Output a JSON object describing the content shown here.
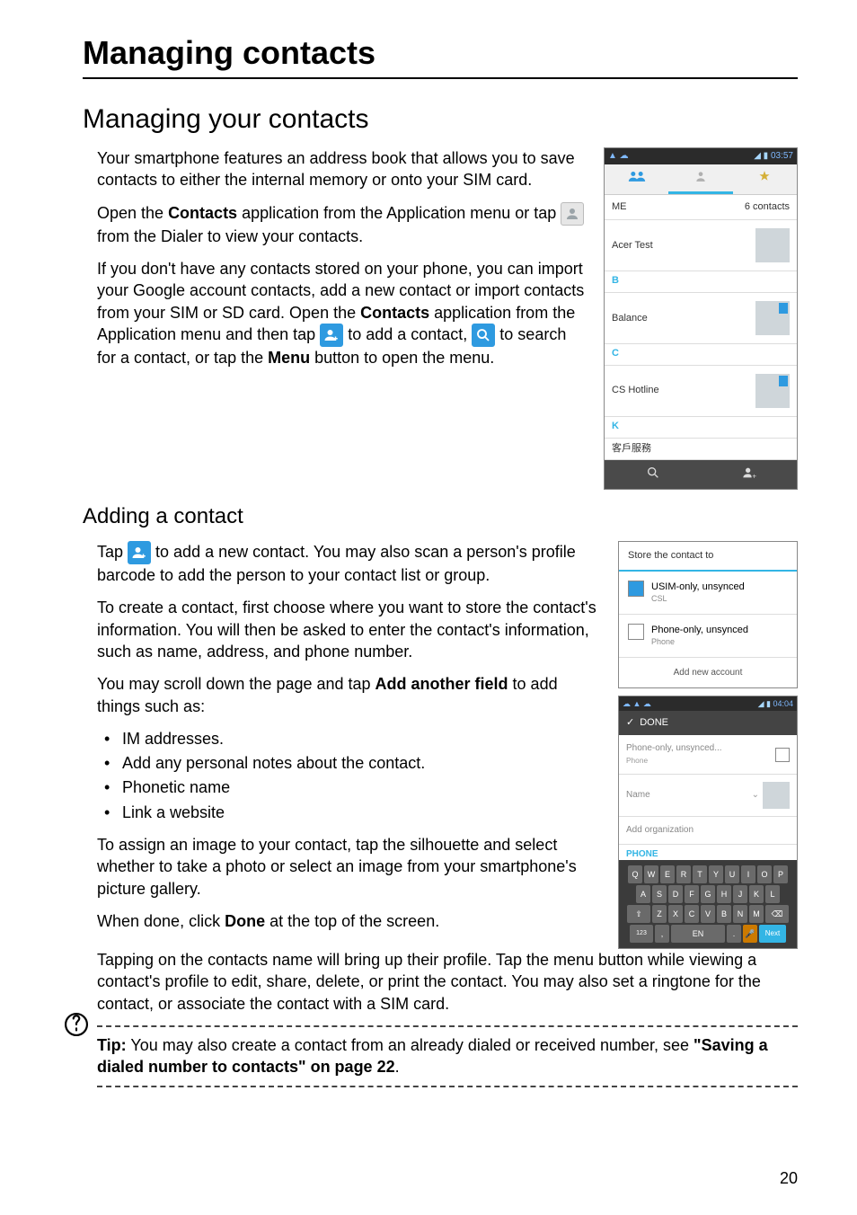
{
  "heading1": "Managing contacts",
  "heading2": "Managing your contacts",
  "heading3": "Adding a contact",
  "intro": {
    "p1": "Your smartphone features an address book that allows you to save contacts to either the internal memory or onto your SIM card.",
    "p2a": "Open the ",
    "p2b": "Contacts",
    "p2c": " application from the Application menu or tap ",
    "p2d": " from the Dialer to view your contacts.",
    "p3": "If you don't have any contacts stored on your phone, you can import your Google account contacts, add a new contact or import contacts from your SIM or SD card. Open the ",
    "p3b": "Contacts",
    "p3c": " application from the Application menu and then tap ",
    "p3d": " to add a contact, ",
    "p3e": " to search for a contact, or tap the ",
    "p3f": "Menu",
    "p3g": " button to open the menu."
  },
  "adding": {
    "p1a": "Tap ",
    "p1b": " to add a new contact. You may also scan a person's profile barcode to add the person to your contact list or group.",
    "p2": "To create a contact, first choose where you want to store the contact's information. You will then be asked to enter the contact's information, such as name, address, and phone number.",
    "p3a": "You may scroll down the page and tap ",
    "p3b": "Add another field",
    "p3c": " to add things such as:",
    "bullets": [
      "IM addresses.",
      "Add any personal notes about the contact.",
      "Phonetic name",
      "Link a website"
    ],
    "p4": "To assign an image to your contact, tap the silhouette and select whether to take a photo or select an image from your smartphone's picture gallery.",
    "p5a": "When done, click ",
    "p5b": "Done",
    "p5c": " at the top of the screen.",
    "p6": "Tapping on the contacts name will bring up their profile. Tap the menu button while viewing a contact's profile to edit, share, delete, or print the contact. You may also set a ringtone for the contact, or associate the contact with a SIM card."
  },
  "tip": {
    "label": "Tip:",
    "text": " You may also create a contact from an already dialed or received number, see ",
    "link": "\"Saving a dialed number to contacts\" on page 22",
    "end": "."
  },
  "phone1": {
    "time": "03:57",
    "me": "ME",
    "count": "6 contacts",
    "sections": {
      "A": "Acer Test",
      "B": "Balance",
      "C": "CS Hotline",
      "K": "客戶服務"
    },
    "letters": [
      "B",
      "C",
      "K"
    ]
  },
  "popup": {
    "title": "Store the contact to",
    "opts": [
      {
        "label": "USIM-only, unsynced",
        "sub": "CSL"
      },
      {
        "label": "Phone-only, unsynced",
        "sub": "Phone"
      }
    ],
    "add": "Add new account"
  },
  "form": {
    "time": "04:04",
    "done": "DONE",
    "acct": "Phone-only, unsynced...",
    "acctsub": "Phone",
    "name": "Name",
    "org": "Add organization",
    "phone": "PHONE",
    "rows": [
      [
        "Q",
        "W",
        "E",
        "R",
        "T",
        "Y",
        "U",
        "I",
        "O",
        "P"
      ],
      [
        "A",
        "S",
        "D",
        "F",
        "G",
        "H",
        "J",
        "K",
        "L"
      ],
      [
        "Z",
        "X",
        "C",
        "V",
        "B",
        "N",
        "M"
      ]
    ],
    "next": "Next",
    "en": "EN"
  },
  "pageNumber": "20"
}
